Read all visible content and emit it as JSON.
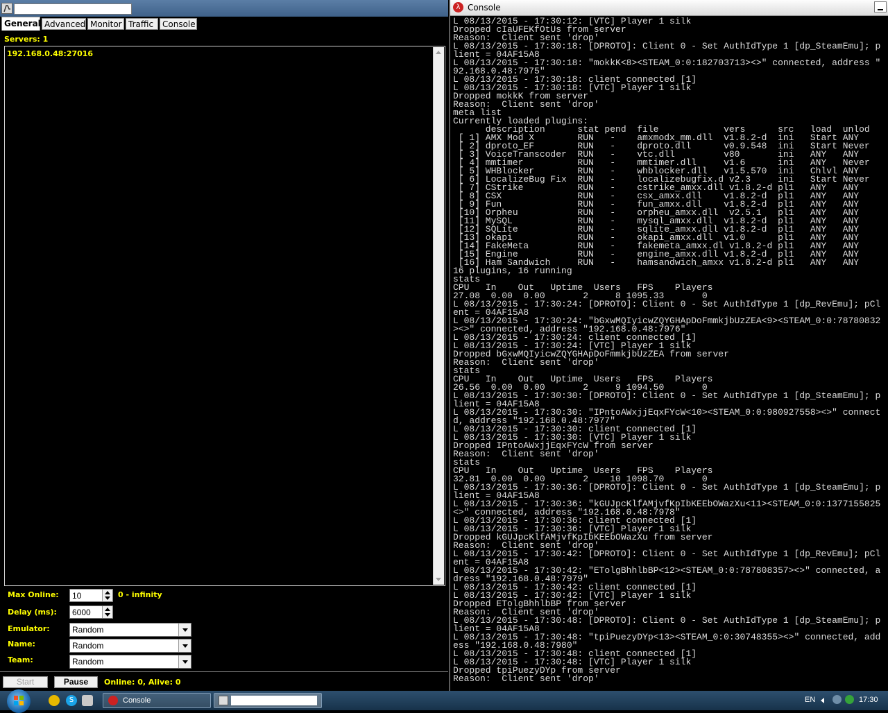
{
  "left_window": {
    "tabs": [
      "General",
      "Advanced",
      "Monitor",
      "Traffic",
      "Console"
    ],
    "servers_label": "Servers: 1",
    "server_items": [
      "192.168.0.48:27016"
    ],
    "form": {
      "max_online_label": "Max Online:",
      "max_online_value": "10",
      "max_online_hint": "0 - infinity",
      "delay_label": "Delay (ms):",
      "delay_value": "6000",
      "emulator_label": "Emulator:",
      "emulator_value": "Random",
      "name_label": "Name:",
      "name_value": "Random",
      "team_label": "Team:",
      "team_value": "Random"
    },
    "start_label": "Start",
    "pause_label": "Pause",
    "status": "Online: 0, Alive: 0"
  },
  "console_window": {
    "title": "Console",
    "lines": [
      "L 08/13/2015 - 17:30:12: [VTC] Player 1 silk",
      "Dropped cIaUFEKfOtUs from server",
      "Reason:  Client sent 'drop'",
      "L 08/13/2015 - 17:30:18: [DPROTO]: Client 0 - Set AuthIdType 1 [dp_SteamEmu]; p",
      "lient = 04AF15A8",
      "L 08/13/2015 - 17:30:18: \"mokkK<8><STEAM_0:0:182703713><>\" connected, address \"",
      "92.168.0.48:7975\"",
      "L 08/13/2015 - 17:30:18: client connected [1]",
      "L 08/13/2015 - 17:30:18: [VTC] Player 1 silk",
      "Dropped mokkK from server",
      "Reason:  Client sent 'drop'",
      "meta list",
      "Currently loaded plugins:",
      "      description      stat pend  file            vers      src   load  unlod",
      " [ 1] AMX Mod X        RUN   -    amxmodx_mm.dll  v1.8.2-d  ini   Start ANY",
      " [ 2] dproto_EF        RUN   -    dproto.dll      v0.9.548  ini   Start Never",
      " [ 3] VoiceTranscoder  RUN   -    vtc.dll         v80       ini   ANY   ANY",
      " [ 4] mmtimer          RUN   -    mmtimer.dll     v1.6      ini   ANY   Never",
      " [ 5] WHBlocker        RUN   -    whblocker.dll   v1.5.570  ini   Chlvl ANY",
      " [ 6] LocalizeBug Fix  RUN   -    localizebugfix.d v2.3     ini   Start Never",
      " [ 7] CStrike          RUN   -    cstrike_amxx.dll v1.8.2-d pl1   ANY   ANY",
      " [ 8] CSX              RUN   -    csx_amxx.dll    v1.8.2-d  pl1   ANY   ANY",
      " [ 9] Fun              RUN   -    fun_amxx.dll    v1.8.2-d  pl1   ANY   ANY",
      " [10] Orpheu           RUN   -    orpheu_amxx.dll  v2.5.1   pl1   ANY   ANY",
      " [11] MySQL            RUN   -    mysql_amxx.dll  v1.8.2-d  pl1   ANY   ANY",
      " [12] SQLite           RUN   -    sqlite_amxx.dll v1.8.2-d  pl1   ANY   ANY",
      " [13] okapi            RUN   -    okapi_amxx.dll  v1.0      pl1   ANY   ANY",
      " [14] FakeMeta         RUN   -    fakemeta_amxx.dl v1.8.2-d pl1   ANY   ANY",
      " [15] Engine           RUN   -    engine_amxx.dll v1.8.2-d  pl1   ANY   ANY",
      " [16] Ham Sandwich     RUN   -    hamsandwich_amxx v1.8.2-d pl1   ANY   ANY",
      "16 plugins, 16 running",
      "stats",
      "CPU   In    Out   Uptime  Users   FPS    Players",
      "27.08  0.00  0.00       2     8 1095.33       0",
      "L 08/13/2015 - 17:30:24: [DPROTO]: Client 0 - Set AuthIdType 1 [dp_RevEmu]; pCl",
      "ent = 04AF15A8",
      "L 08/13/2015 - 17:30:24: \"bGxwMQIyicwZQYGHApDoFmmkjbUzZEA<9><STEAM_0:0:78780832",
      "><>\" connected, address \"192.168.0.48:7976\"",
      "L 08/13/2015 - 17:30:24: client connected [1]",
      "L 08/13/2015 - 17:30:24: [VTC] Player 1 silk",
      "Dropped bGxwMQIyicwZQYGHApDoFmmkjbUzZEA from server",
      "Reason:  Client sent 'drop'",
      "stats",
      "CPU   In    Out   Uptime  Users   FPS    Players",
      "26.56  0.00  0.00       2     9 1094.50       0",
      "L 08/13/2015 - 17:30:30: [DPROTO]: Client 0 - Set AuthIdType 1 [dp_SteamEmu]; p",
      "lient = 04AF15A8",
      "L 08/13/2015 - 17:30:30: \"IPntoAWxjjEqxFYcW<10><STEAM_0:0:980927558><>\" connect",
      "d, address \"192.168.0.48:7977\"",
      "L 08/13/2015 - 17:30:30: client connected [1]",
      "L 08/13/2015 - 17:30:30: [VTC] Player 1 silk",
      "Dropped IPntoAWxjjEqxFYcW from server",
      "Reason:  Client sent 'drop'",
      "stats",
      "CPU   In    Out   Uptime  Users   FPS    Players",
      "32.81  0.00  0.00       2    10 1098.70       0",
      "L 08/13/2015 - 17:30:36: [DPROTO]: Client 0 - Set AuthIdType 1 [dp_SteamEmu]; p",
      "lient = 04AF15A8",
      "L 08/13/2015 - 17:30:36: \"kGUJpcKlfAMjvfKpIbKEEbOWazXu<11><STEAM_0:0:1377155825",
      "<>\" connected, address \"192.168.0.48:7978\"",
      "L 08/13/2015 - 17:30:36: client connected [1]",
      "L 08/13/2015 - 17:30:36: [VTC] Player 1 silk",
      "Dropped kGUJpcKlfAMjvfKpIbKEEbOWazXu from server",
      "Reason:  Client sent 'drop'",
      "L 08/13/2015 - 17:30:42: [DPROTO]: Client 0 - Set AuthIdType 1 [dp_RevEmu]; pCl",
      "ent = 04AF15A8",
      "L 08/13/2015 - 17:30:42: \"ETolgBhhlbBP<12><STEAM_0:0:787808357><>\" connected, a",
      "dress \"192.168.0.48:7979\"",
      "L 08/13/2015 - 17:30:42: client connected [1]",
      "L 08/13/2015 - 17:30:42: [VTC] Player 1 silk",
      "Dropped ETolgBhhlbBP from server",
      "Reason:  Client sent 'drop'",
      "L 08/13/2015 - 17:30:48: [DPROTO]: Client 0 - Set AuthIdType 1 [dp_SteamEmu]; p",
      "lient = 04AF15A8",
      "L 08/13/2015 - 17:30:48: \"tpiPuezyDYp<13><STEAM_0:0:30748355><>\" connected, add",
      "ess \"192.168.0.48:7980\"",
      "L 08/13/2015 - 17:30:48: client connected [1]",
      "L 08/13/2015 - 17:30:48: [VTC] Player 1 silk",
      "Dropped tpiPuezyDYp from server",
      "Reason:  Client sent 'drop'"
    ]
  },
  "taskbar": {
    "console_task_label": "Console",
    "language": "EN",
    "clock": "17:30"
  },
  "colors": {
    "accent_text": "#ffff00",
    "console_text": "#dcdcdc",
    "background": "#000000"
  }
}
